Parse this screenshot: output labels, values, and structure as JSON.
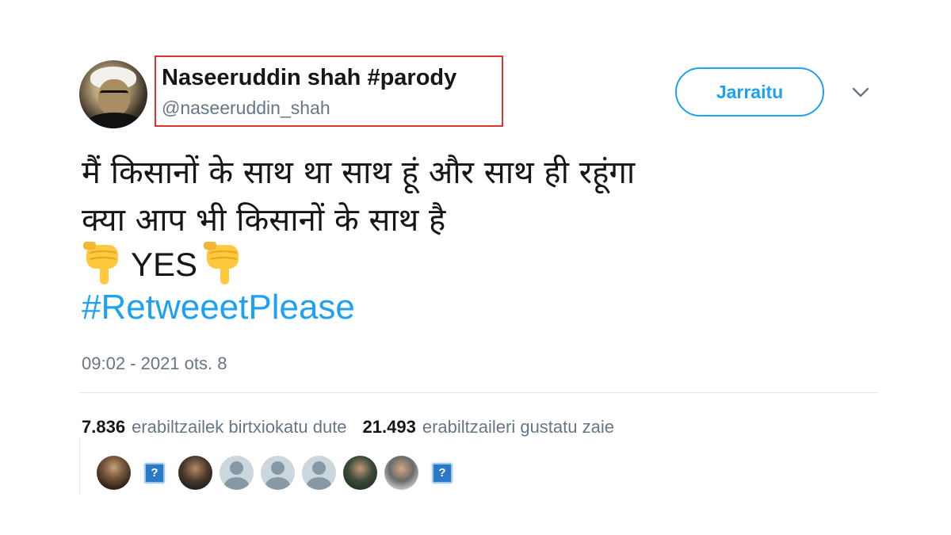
{
  "tweet": {
    "display_name": "Naseeruddin shah #parody",
    "handle": "@naseeruddin_shah",
    "follow_label": "Jarraitu",
    "text_line1": "मैं किसानों के साथ था साथ हूं और साथ ही रहूंगा",
    "text_line2": "क्या आप भी किसानों के साथ है",
    "yes_text": "YES",
    "hashtag": "#RetweeetPlease",
    "timestamp": "09:02 - 2021 ots. 8",
    "emoji": "backhand-index-pointing-down"
  },
  "stats": {
    "retweets_count": "7.836",
    "retweets_label": "erabiltzailek birtxiokatu dute",
    "likes_count": "21.493",
    "likes_label": "erabiltzaileri gustatu zaie"
  },
  "likers": {
    "placeholder_glyph": "?"
  },
  "colors": {
    "accent": "#1da1f2",
    "highlight_box": "#e0342b",
    "secondary_text": "#657786"
  }
}
